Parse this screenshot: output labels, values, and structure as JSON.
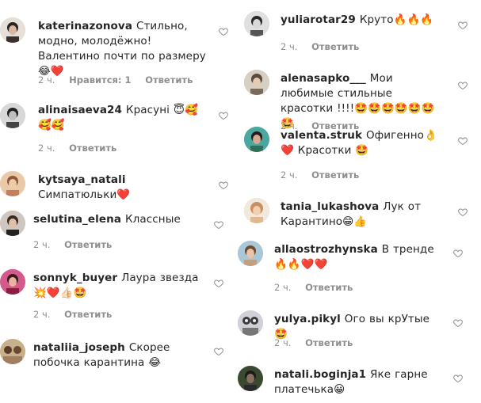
{
  "icons": {
    "like": "heart-outline-icon",
    "emoji_sets": "emoji"
  },
  "colors": {
    "text": "#262626",
    "meta": "#8e8e8e"
  },
  "left": [
    {
      "user": "katerinazonova",
      "text": "Стильно, модно, молодёжно! Валентино почти по размеру😂❤️",
      "time": "2 ч.",
      "likes": "Нравится: 1",
      "reply": "Ответить"
    },
    {
      "user": "alinaisaeva24",
      "text": "Красуні 😇🥰🥰🥰",
      "time": "2 ч.",
      "reply": "Ответить"
    },
    {
      "user": "kytsaya_natali",
      "text": "Симпатюльки❤️",
      "time": "",
      "reply": ""
    },
    {
      "user": "selutina_elena",
      "text": "Классные",
      "time": "2 ч.",
      "reply": "Ответить"
    },
    {
      "user": "sonnyk_buyer",
      "text": "Лаура звезда 💥❤️👍🏻🤩",
      "time": "2 ч.",
      "reply": "Ответить"
    },
    {
      "user": "nataliia_joseph",
      "text": "Скорее побочка карантина 😂",
      "time": "",
      "reply": ""
    }
  ],
  "right": [
    {
      "user": "yuliarotar29",
      "text": "Круто🔥🔥🔥",
      "time": "2 ч.",
      "reply": "Ответить"
    },
    {
      "user": "alenasapko___",
      "text": "Мои любимые стильные красотки !!!!🤩🤩🤩🤩🤩🤩🤩",
      "time": "2 ч.",
      "reply": "Ответить"
    },
    {
      "user": "valenta.struk",
      "text": "Офигенно👌❤️ Красотки 🤩",
      "time": "2 ч.",
      "reply": "Ответить"
    },
    {
      "user": "tania_lukashova",
      "text": "Лук от Карантино😁👍",
      "time": "",
      "reply": ""
    },
    {
      "user": "allaostrozhynska",
      "text": "В тренде 🔥🔥❤️❤️",
      "time": "2 ч.",
      "reply": "Ответить"
    },
    {
      "user": "yulya.pikyl",
      "text": "Ого вы крУтые 🤩",
      "time": "2 ч.",
      "reply": "Ответить"
    },
    {
      "user": "natali.boginja1",
      "text": "Яке гарне платечька😀",
      "time": "",
      "reply": ""
    }
  ]
}
